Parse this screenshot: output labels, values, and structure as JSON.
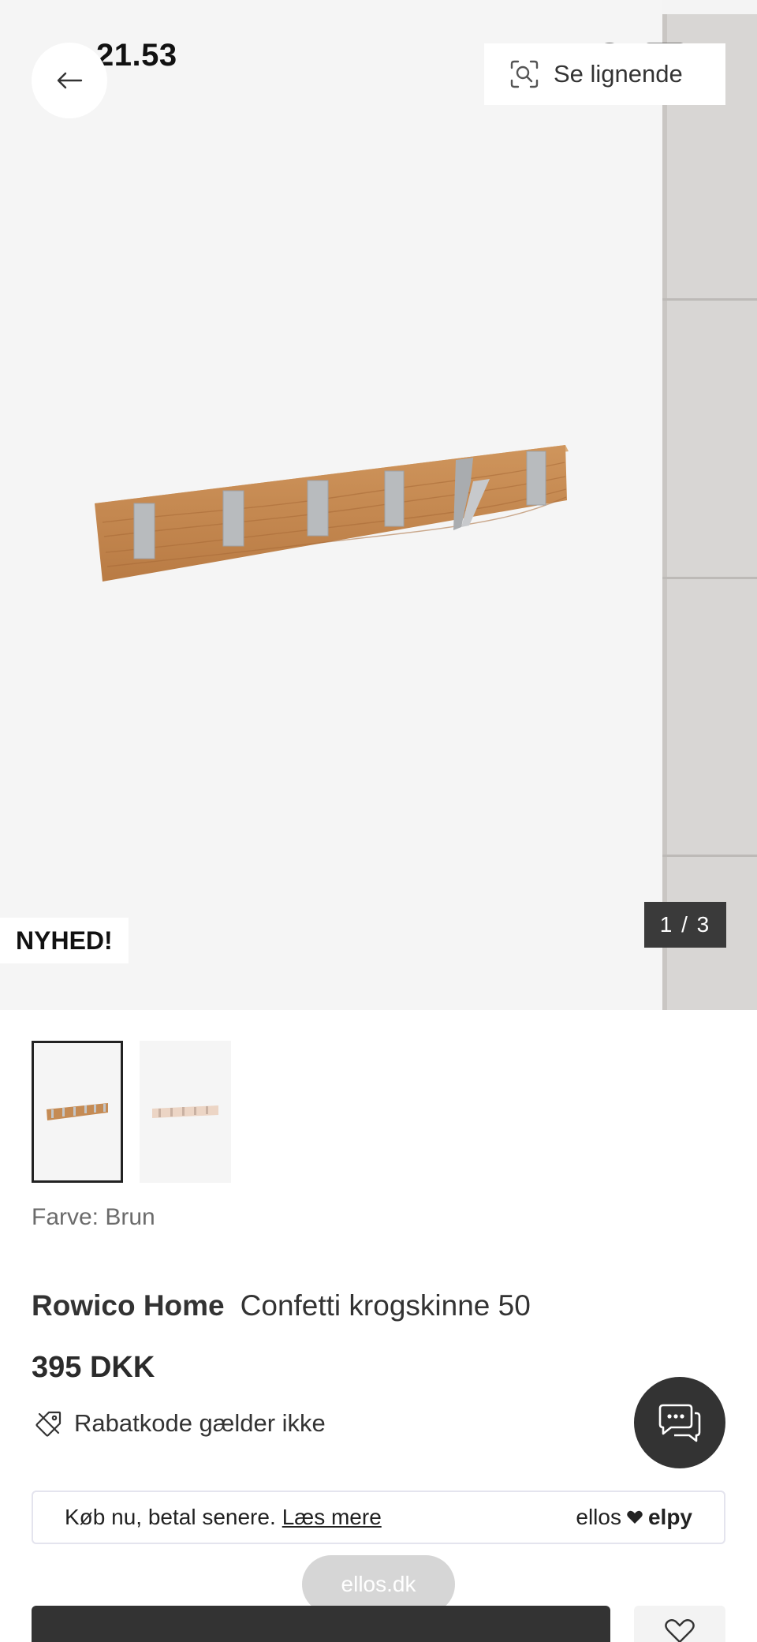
{
  "status_bar": {
    "time": "21.53",
    "icons": [
      "signal-icon",
      "wifi-icon",
      "battery-icon"
    ]
  },
  "header": {
    "back_icon": "arrow-left-icon",
    "similar_label": "Se lignende",
    "similar_icon": "visual-search-icon"
  },
  "gallery": {
    "badge": "NYHED!",
    "counter": "1 / 3",
    "current_index": 1,
    "total": 3
  },
  "thumbnails": [
    {
      "name": "thumbnail-1",
      "selected": true
    },
    {
      "name": "thumbnail-2",
      "selected": false
    }
  ],
  "product": {
    "color_label": "Farve: Brun",
    "brand": "Rowico Home",
    "name": "Confetti krogskinne 50",
    "price": "395 DKK",
    "promo_text": "Rabatkode gælder ikke",
    "promo_icon": "tag-slash-icon"
  },
  "bnpl": {
    "text": "Køb nu, betal senere.",
    "link": "Læs mere",
    "brand_left": "ellos",
    "brand_right": "elpy"
  },
  "browser": {
    "url": "ellos.dk"
  },
  "colors": {
    "dark": "#333333",
    "image_bg": "#f5f5f5",
    "wood": "#c98d55",
    "hook": "#b9bcbf"
  }
}
